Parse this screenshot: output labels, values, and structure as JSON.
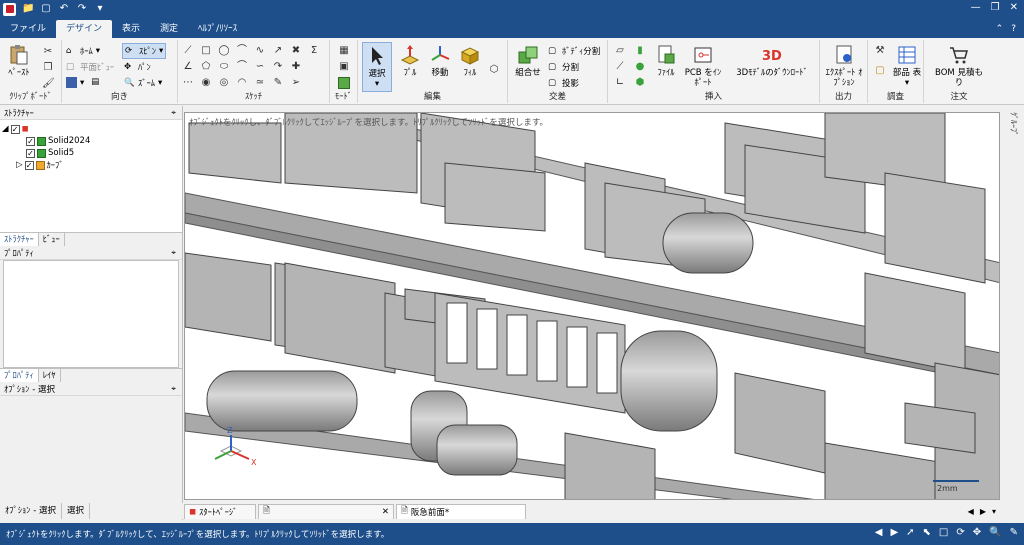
{
  "tabs": [
    "ファイル",
    "デザイン",
    "表示",
    "測定",
    "ﾍﾙﾌﾟ/ﾘｿｰｽ"
  ],
  "ribbon": {
    "clipboard": {
      "paste": "ﾍﾟｰｽﾄ",
      "label": "ｸﾘｯﾌﾟﾎﾞｰﾄﾞ"
    },
    "orient": {
      "home": "ﾎｰﾑ",
      "plane_view": "平面ﾋﾞｭｰ",
      "spin": "ｽﾋﾟﾝ",
      "pan": "ﾊﾟﾝ",
      "zoom": "ｽﾞｰﾑ",
      "label": "向き"
    },
    "sketch": {
      "label": "ｽｹｯﾁ"
    },
    "mode": {
      "label": "ﾓｰﾄﾞ"
    },
    "edit": {
      "select": "選択",
      "pull": "ﾌﾟﾙ",
      "move": "移動",
      "fill": "ﾌｨﾙ",
      "label": "編集"
    },
    "intersect": {
      "combine": "組合せ",
      "split_body": "ﾎﾞﾃﾞｨ分割",
      "split": "分割",
      "project": "投影",
      "label": "交差"
    },
    "insert": {
      "file": "ﾌｧｲﾙ",
      "pcb": "PCB をｲﾝﾎﾟｰﾄ",
      "download3d": "3Dﾓﾃﾞﾙのﾀﾞｳﾝﾛｰﾄﾞ",
      "label": "挿入"
    },
    "output": {
      "export": "ｴｸｽﾎﾟｰﾄ ｵﾌﾟｼｮﾝ",
      "label": "出力"
    },
    "survey": {
      "bom_table": "部品 表",
      "label": "調査"
    },
    "order": {
      "bom_quote": "BOM 見積も り",
      "label": "注文"
    }
  },
  "structure": {
    "title": "ｽﾄﾗｸﾁｬｰ",
    "items": [
      "Solid2024",
      "Solid5",
      "ｶｰﾌﾞ"
    ],
    "tabs": [
      "ｽﾄﾗｸﾁｬｰ",
      "ﾋﾞｭｰ"
    ]
  },
  "properties": {
    "title": "ﾌﾟﾛﾊﾟﾃｨ",
    "tabs": [
      "ﾌﾟﾛﾊﾟﾃｨ",
      "ﾚｲﾔ"
    ]
  },
  "options": {
    "title": "ｵﾌﾟｼｮﾝ - 選択"
  },
  "viewport": {
    "hint": "ｵﾌﾞｼﾞｪｸﾄをｸﾘｯｸし、ﾀﾞﾌﾞﾙｸﾘｯｸしてｴｯｼﾞﾙｰﾌﾟを選択します。ﾄﾘﾌﾟﾙｸﾘｯｸしてｿﾘｯﾄﾞを選択します。",
    "scale": "2mm",
    "side_tab": "ｸﾞﾙｰﾌﾟ"
  },
  "bottom_left_tabs": [
    "ｵﾌﾟｼｮﾝ - 選択",
    "選択"
  ],
  "doc_tabs": [
    "ｽﾀｰﾄﾍﾟｰｼﾞ",
    "",
    "阪急前面*"
  ],
  "status": "ｵﾌﾞｼﾞｪｸﾄをｸﾘｯｸします。ﾀﾞﾌﾞﾙｸﾘｯｸして、ｴｯｼﾞﾙｰﾌﾟを選択します。ﾄﾘﾌﾟﾙｸﾘｯｸしてｿﾘｯﾄﾞを選択します。"
}
